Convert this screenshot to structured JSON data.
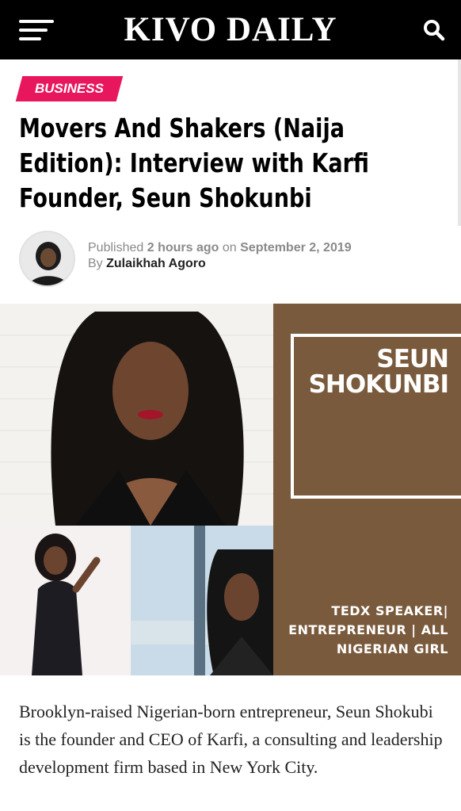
{
  "header": {
    "brand": "KIVO DAILY",
    "menu_icon": "hamburger-menu-icon",
    "search_icon": "search-icon",
    "background_color": "#000000"
  },
  "article": {
    "category": "BUSINESS",
    "category_color": "#e8175d",
    "title": "Movers And Shakers (Naija\nEdition): Interview with Karfi\nFounder, Seun Shokunbi",
    "meta": {
      "published_prefix": "Published",
      "relative_time": "2 hours ago",
      "on_word": "on",
      "date": "September 2, 2019",
      "by_word": "By",
      "author": "Zulaikhah Agoro"
    },
    "feature_image": {
      "name": "SEUN\nSHOKUNBI",
      "tagline": "TEDX SPEAKER|\nENTREPRENEUR | ALL\nNIGERIAN GIRL",
      "panel_color": "#7a5a3c"
    },
    "intro": "Brooklyn-raised Nigerian-born entrepreneur, Seun Shokubi is the founder and CEO of Karfi, a consulting and leadership development firm based in New York City."
  }
}
